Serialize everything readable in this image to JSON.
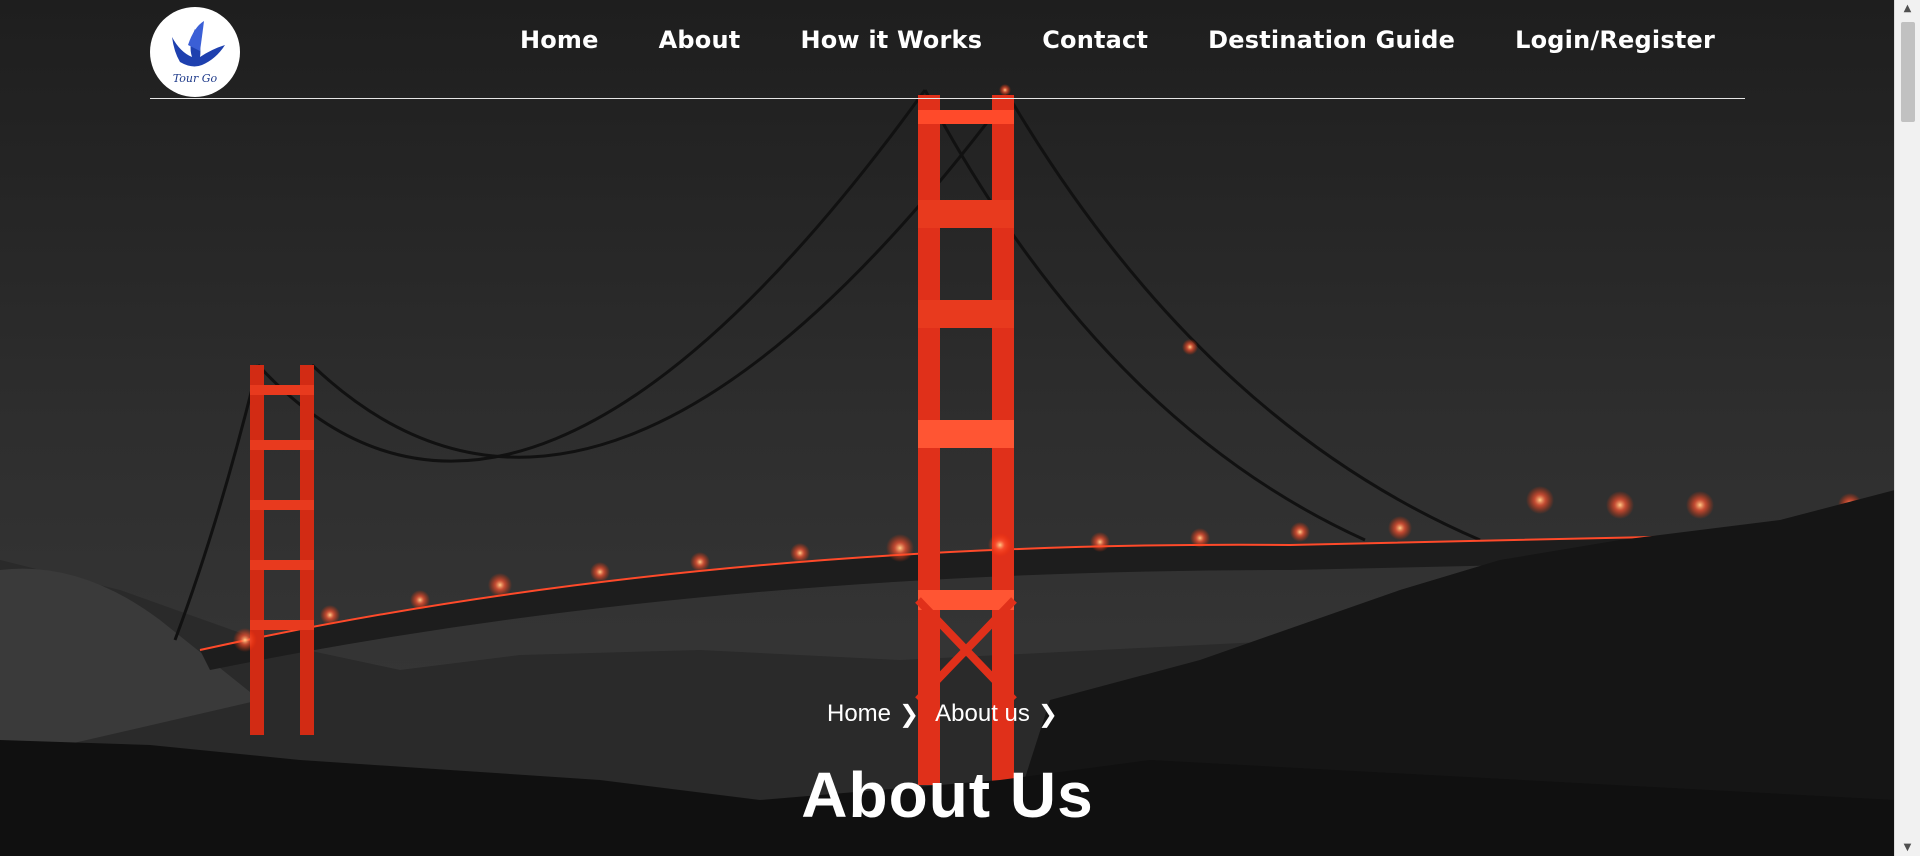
{
  "brand": {
    "logo_text": "Tour Go",
    "logo_icon": "bird-icon"
  },
  "nav": {
    "items": [
      {
        "label": "Home"
      },
      {
        "label": "About"
      },
      {
        "label": "How it Works"
      },
      {
        "label": "Contact"
      },
      {
        "label": "Destination Guide"
      },
      {
        "label": "Login/Register"
      }
    ]
  },
  "hero": {
    "image": "golden-gate-bridge-night-photo",
    "breadcrumb": [
      {
        "label": "Home"
      },
      {
        "label": "About us"
      }
    ],
    "title": "About Us"
  },
  "colors": {
    "bridge_red": "#e8331c",
    "text": "#ffffff",
    "background": "#1b1b1b"
  }
}
